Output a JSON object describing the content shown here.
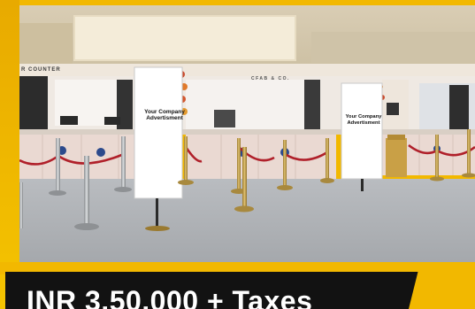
{
  "ad_boards": [
    {
      "text": "Your Company Advertisment"
    },
    {
      "text": "Your Company Advertisment"
    }
  ],
  "signage": {
    "left_counter": "R COUNTER",
    "center_counter": "CFAB & CO."
  },
  "banner": {
    "price": "INR 3,50,000 + Taxes"
  },
  "colors": {
    "frame_yellow": "#f2b800",
    "banner_black": "#121212",
    "rope_red": "#b0202a",
    "brass": "#c9a24a"
  }
}
